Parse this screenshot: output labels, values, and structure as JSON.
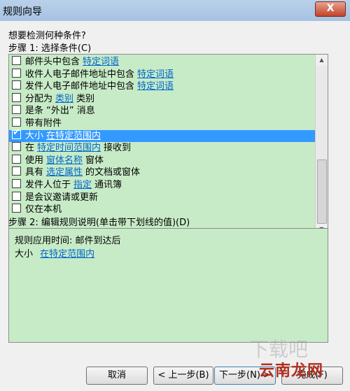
{
  "window": {
    "title": "规则向导",
    "close_glyph": "X"
  },
  "dialog": {
    "prompt": "想要检测何种条件?",
    "step1_label": "步骤 1: 选择条件(C)",
    "conditions": [
      {
        "pre": "邮件头中包含",
        "link": "特定词语",
        "post": "",
        "checked": false,
        "selected": false
      },
      {
        "pre": "收件人电子邮件地址中包含",
        "link": "特定词语",
        "post": "",
        "checked": false,
        "selected": false
      },
      {
        "pre": "发件人电子邮件地址中包含",
        "link": "特定词语",
        "post": "",
        "checked": false,
        "selected": false
      },
      {
        "pre": "分配为",
        "link": "类别",
        "post": "类别",
        "checked": false,
        "selected": false
      },
      {
        "pre": "是条 “外出” 消息",
        "link": "",
        "post": "",
        "checked": false,
        "selected": false
      },
      {
        "pre": "带有附件",
        "link": "",
        "post": "",
        "checked": false,
        "selected": false
      },
      {
        "pre": "大小",
        "link": "在特定范围内",
        "post": "",
        "checked": true,
        "selected": true
      },
      {
        "pre": "在",
        "link": "特定时间范围内",
        "post": "接收到",
        "checked": false,
        "selected": false
      },
      {
        "pre": "使用",
        "link": "窗体名称",
        "post": "窗体",
        "checked": false,
        "selected": false
      },
      {
        "pre": "具有",
        "link": "选定属性",
        "post": "的文档或窗体",
        "checked": false,
        "selected": false
      },
      {
        "pre": "发件人位于",
        "link": "指定",
        "post": "通讯簿",
        "checked": false,
        "selected": false
      },
      {
        "pre": "是会议邀请或更新",
        "link": "",
        "post": "",
        "checked": false,
        "selected": false
      },
      {
        "pre": "仅在本机",
        "link": "",
        "post": "",
        "checked": false,
        "selected": false
      }
    ],
    "step2_label": "步骤 2: 编辑规则说明(单击带下划线的值)(D)",
    "description": {
      "line1": "规则应用时间: 邮件到达后",
      "line2_pre": "大小",
      "line2_link": "在特定范围内"
    },
    "buttons": {
      "cancel": "取消",
      "back": "< 上一步(B)",
      "next": "下一步(N) >",
      "finish": "完成(F)"
    }
  },
  "watermark": {
    "text": "云南龙网",
    "faint": "下载吧"
  },
  "colors": {
    "list_bg": "#c7ebc7",
    "selection": "#3399ff",
    "link": "#0066cc"
  }
}
